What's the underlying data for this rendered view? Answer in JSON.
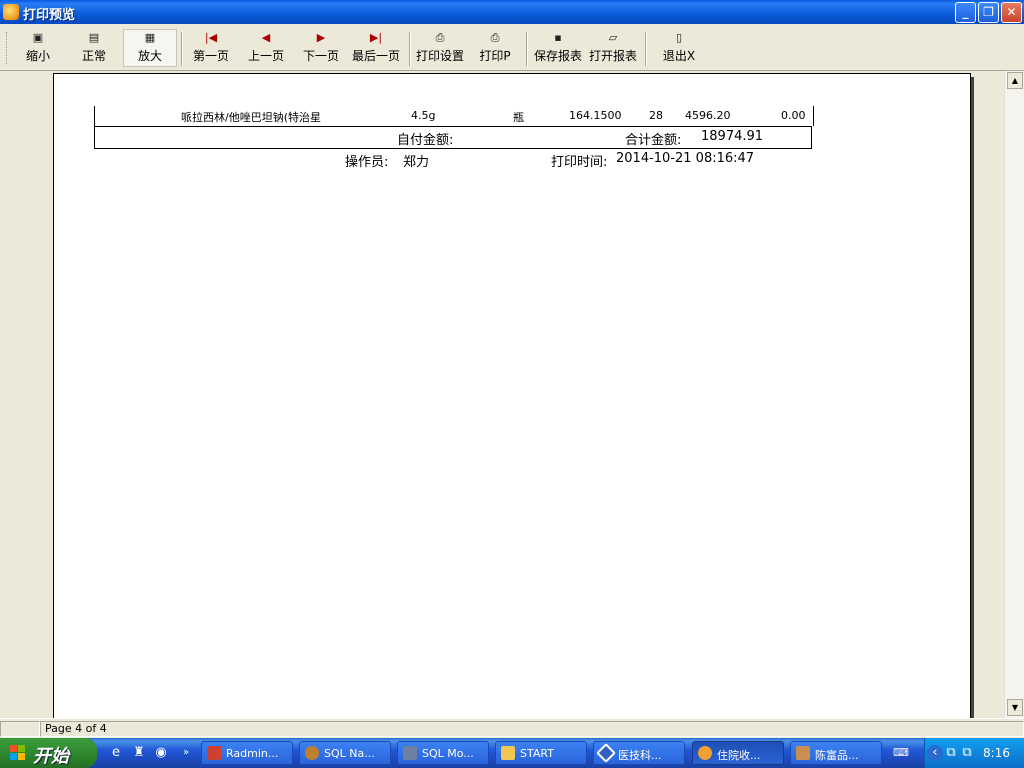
{
  "window": {
    "title": "打印预览"
  },
  "toolbar": {
    "zoom_out": "缩小",
    "normal": "正常",
    "zoom_in": "放大",
    "first_page": "第一页",
    "prev_page": "上一页",
    "next_page": "下一页",
    "last_page": "最后一页",
    "print_setup": "打印设置",
    "print": "打印P",
    "save_report": "保存报表",
    "open_report": "打开报表",
    "exit": "退出X"
  },
  "report": {
    "row": {
      "name": "哌拉西林/他唑巴坦钠(特治星",
      "spec": "4.5g",
      "unit": "瓶",
      "price": "164.1500",
      "qty": "28",
      "amount": "4596.20",
      "other": "0.00"
    },
    "self_pay_label": "自付金额:",
    "total_label": "合计金额:",
    "total_value": "18974.91",
    "operator_label": "操作员:",
    "operator_name": "郑力",
    "print_time_label": "打印时间:",
    "print_time": "2014-10-21 08:16:47"
  },
  "status": {
    "page": "Page 4 of 4"
  },
  "taskbar": {
    "start": "开始",
    "tasks": [
      "Radmin...",
      "SQL Na...",
      "SQL Mo...",
      "START",
      "医技科...",
      "住院收...",
      "陈富品..."
    ],
    "clock": "8:16"
  }
}
